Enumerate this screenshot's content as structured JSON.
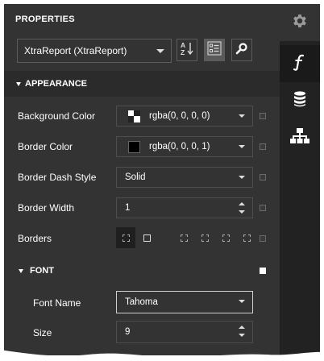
{
  "panel": {
    "title": "PROPERTIES",
    "object_selector": {
      "value": "XtraReport (XtraReport)"
    },
    "toolbar": [
      {
        "name": "sort-alphabetical-button",
        "icon": "sort-az-icon",
        "active": false
      },
      {
        "name": "categorized-view-button",
        "icon": "categorized-list-icon",
        "active": true
      },
      {
        "name": "search-button",
        "icon": "search-icon",
        "active": false
      }
    ]
  },
  "sidebar": {
    "tabs": [
      {
        "name": "settings",
        "icon": "gear-icon"
      },
      {
        "name": "expressions",
        "icon": "function-icon"
      },
      {
        "name": "field-list",
        "icon": "database-icon"
      },
      {
        "name": "report-explorer",
        "icon": "hierarchy-icon"
      }
    ]
  },
  "appearance": {
    "label": "APPEARANCE",
    "properties": {
      "background_color": {
        "label": "Background Color",
        "value": "rgba(0, 0, 0, 0)"
      },
      "border_color": {
        "label": "Border Color",
        "value": "rgba(0, 0, 0, 1)"
      },
      "border_dash_style": {
        "label": "Border Dash Style",
        "value": "Solid"
      },
      "border_width": {
        "label": "Border Width",
        "value": "1"
      },
      "borders": {
        "label": "Borders"
      }
    }
  },
  "font": {
    "label": "FONT",
    "properties": {
      "font_name": {
        "label": "Font Name",
        "value": "Tahoma"
      },
      "size": {
        "label": "Size",
        "value": "9"
      }
    }
  },
  "colors": {
    "panel_bg": "#333333",
    "sidebar_bg": "#222222",
    "text": "#ffffff",
    "border": "#4e4e4e"
  }
}
